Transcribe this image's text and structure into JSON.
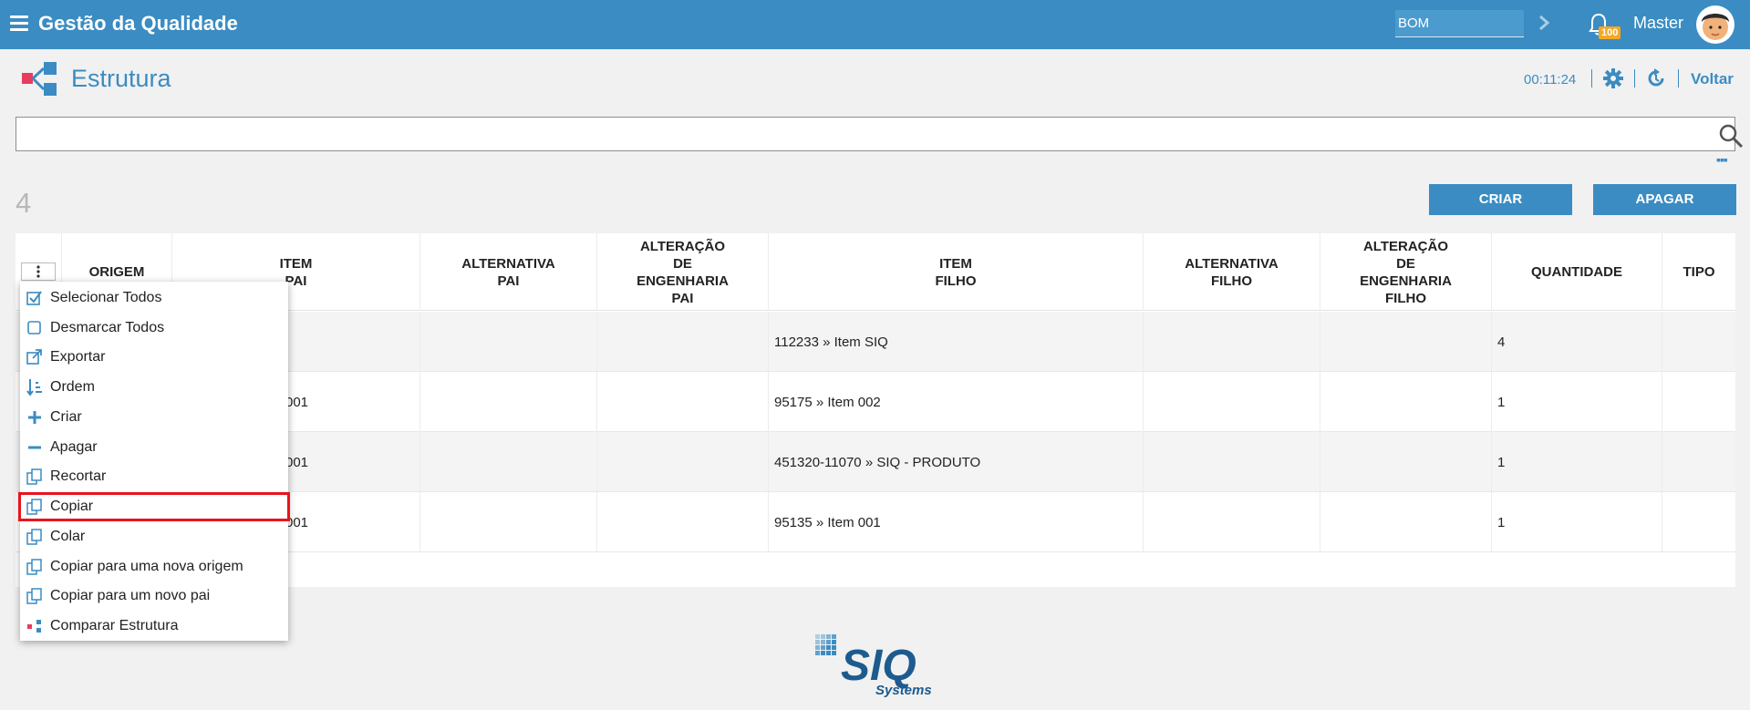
{
  "header": {
    "app_title": "Gestão da Qualidade",
    "bom_value": "BOM",
    "notification_count": "100",
    "user_name": "Master"
  },
  "page": {
    "title": "Estrutura",
    "timer": "00:11:24",
    "back_label": "Voltar"
  },
  "search": {
    "value": "",
    "placeholder": ""
  },
  "toolbar": {
    "record_count": "4",
    "create_label": "CRIAR",
    "delete_label": "APAGAR"
  },
  "table": {
    "columns": [
      "ORIGEM",
      "ITEM\nPAI",
      "ALTERNATIVA\nPAI",
      "ALTERAÇÃO\nDE\nENGENHARIA\nPAI",
      "ITEM\nFILHO",
      "ALTERNATIVA\nFILHO",
      "ALTERAÇÃO\nDE\nENGENHARIA\nFILHO",
      "QUANTIDADE",
      "TIPO"
    ],
    "rows": [
      {
        "item_pai": "",
        "item_filho": "112233 » Item SIQ",
        "quantidade": "4"
      },
      {
        "item_pai": "001",
        "item_filho": "95175 » Item 002",
        "quantidade": "1"
      },
      {
        "item_pai": "001",
        "item_filho": "451320-11070 » SIQ - PRODUTO",
        "quantidade": "1"
      },
      {
        "item_pai": "001",
        "item_filho": "95135 » Item 001",
        "quantidade": "1"
      }
    ]
  },
  "context_menu": {
    "items": [
      {
        "label": "Selecionar Todos",
        "icon": "checkbox-checked-icon"
      },
      {
        "label": "Desmarcar Todos",
        "icon": "checkbox-empty-icon"
      },
      {
        "label": "Exportar",
        "icon": "export-icon"
      },
      {
        "label": "Ordem",
        "icon": "sort-icon"
      },
      {
        "label": "Criar",
        "icon": "plus-icon"
      },
      {
        "label": "Apagar",
        "icon": "minus-icon"
      },
      {
        "label": "Recortar",
        "icon": "copy-icon"
      },
      {
        "label": "Copiar",
        "icon": "copy-icon"
      },
      {
        "label": "Colar",
        "icon": "copy-icon"
      },
      {
        "label": "Copiar para uma nova origem",
        "icon": "copy-icon"
      },
      {
        "label": "Copiar para um novo pai",
        "icon": "copy-icon"
      },
      {
        "label": "Comparar Estrutura",
        "icon": "structure-icon"
      }
    ],
    "highlighted_index": 7
  },
  "footer": {
    "logo_text": "SIQ",
    "logo_subtext": "Systems"
  },
  "colors": {
    "primary": "#3b8cc2",
    "badge": "#f4a823",
    "highlight": "#e8141c",
    "accent_red": "#e63d5f"
  }
}
